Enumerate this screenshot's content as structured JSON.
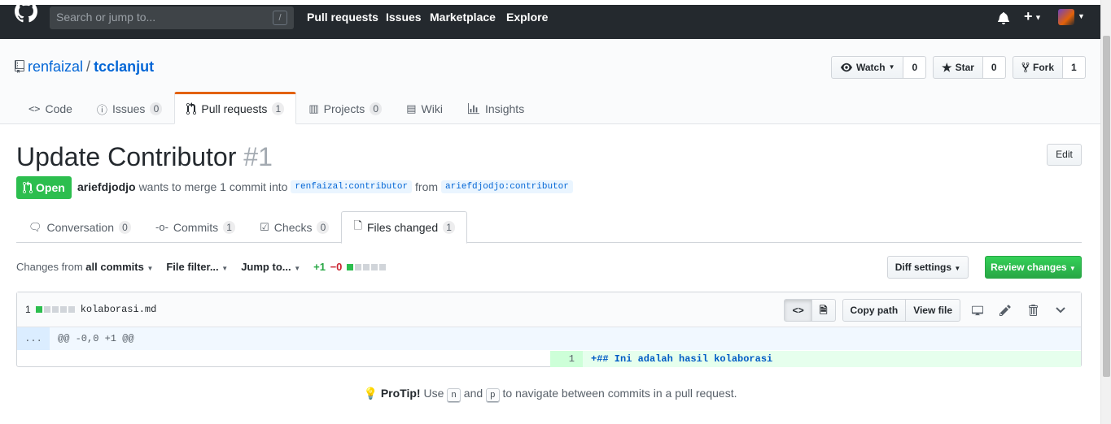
{
  "header": {
    "search_placeholder": "Search or jump to...",
    "search_key": "/",
    "nav": [
      "Pull requests",
      "Issues",
      "Marketplace",
      "Explore"
    ]
  },
  "repo": {
    "owner": "renfaizal",
    "separator": "/",
    "name": "tcclanjut",
    "watch_label": "Watch",
    "watch_count": "0",
    "star_label": "Star",
    "star_count": "0",
    "fork_label": "Fork",
    "fork_count": "1",
    "tabs": [
      {
        "label": "Code",
        "counter": ""
      },
      {
        "label": "Issues",
        "counter": "0"
      },
      {
        "label": "Pull requests",
        "counter": "1"
      },
      {
        "label": "Projects",
        "counter": "0"
      },
      {
        "label": "Wiki",
        "counter": ""
      },
      {
        "label": "Insights",
        "counter": ""
      }
    ]
  },
  "pr": {
    "title": "Update Contributor",
    "number": "#1",
    "edit_label": "Edit",
    "state": "Open",
    "author": "ariefdjodjo",
    "merge_text": "wants to merge 1 commit into",
    "base_branch": "renfaizal:contributor",
    "from_text": "from",
    "head_branch": "ariefdjodjo:contributor",
    "tabs": [
      {
        "label": "Conversation",
        "counter": "0"
      },
      {
        "label": "Commits",
        "counter": "1"
      },
      {
        "label": "Checks",
        "counter": "0"
      },
      {
        "label": "Files changed",
        "counter": "1"
      }
    ]
  },
  "toolbar": {
    "changes_from": "Changes from",
    "all_commits": "all commits",
    "file_filter": "File filter...",
    "jump_to": "Jump to...",
    "additions": "+1",
    "deletions": "−0",
    "diff_settings": "Diff settings",
    "review_changes": "Review changes"
  },
  "file": {
    "changes": "1",
    "name": "kolaborasi.md",
    "copy_path": "Copy path",
    "view_file": "View file",
    "expander": "...",
    "hunk_header": "@@ -0,0 +1 @@",
    "line_number": "1",
    "line_code": "+## Ini adalah hasil kolaborasi"
  },
  "protip": {
    "label": "ProTip!",
    "use": "Use",
    "key_n": "n",
    "and": "and",
    "key_p": "p",
    "rest": "to navigate between commits in a pull request."
  },
  "colors": {
    "header_bg": "#24292e",
    "link": "#0366d6",
    "open_green": "#2cbe4e",
    "tab_accent": "#e36209"
  }
}
